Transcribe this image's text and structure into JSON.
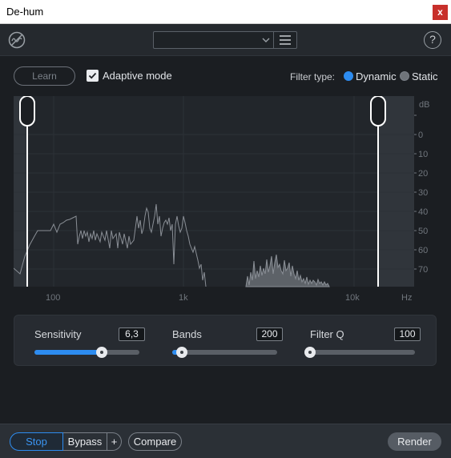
{
  "window": {
    "title": "De-hum",
    "close_label": "x"
  },
  "toolbar": {
    "preset_value": "",
    "logo_icon": "no-hum-icon",
    "menu_icon": "hamburger-menu-icon",
    "help_label": "?"
  },
  "controls": {
    "learn_label": "Learn",
    "adaptive_label": "Adaptive mode",
    "adaptive_checked": true,
    "filter_type_label": "Filter type:",
    "filter_options": [
      {
        "label": "Dynamic",
        "selected": true
      },
      {
        "label": "Static",
        "selected": false
      }
    ]
  },
  "spectrum": {
    "db_label": "dB",
    "db_ticks": [
      "0",
      "10",
      "20",
      "30",
      "40",
      "50",
      "60",
      "70"
    ],
    "freq_ticks": [
      "100",
      "1k",
      "10k"
    ],
    "hz_label": "Hz"
  },
  "params": {
    "sensitivity": {
      "label": "Sensitivity",
      "value": "6,3",
      "level": 0.64
    },
    "bands": {
      "label": "Bands",
      "value": "200",
      "level": 0.09
    },
    "filter_q": {
      "label": "Filter Q",
      "value": "100",
      "level": 0.0
    }
  },
  "footer": {
    "stop_label": "Stop",
    "bypass_label": "Bypass",
    "plus_label": "+",
    "compare_label": "Compare",
    "render_label": "Render"
  },
  "colors": {
    "accent": "#2d8cf0",
    "background": "#1b1e22",
    "close": "#c8302b"
  }
}
